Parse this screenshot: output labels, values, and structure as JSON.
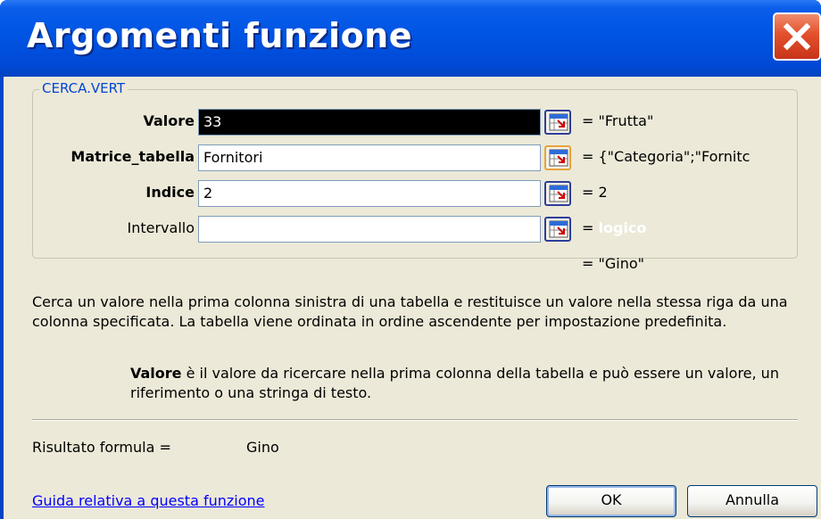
{
  "window": {
    "title": "Argomenti funzione"
  },
  "function_group": {
    "name": "CERCA.VERT",
    "arguments": [
      {
        "label": "Valore",
        "value": "33",
        "preview": "= \"Frutta\""
      },
      {
        "label": "Matrice_tabella",
        "value": "Fornitori",
        "preview": "= {\"Categoria\";\"Fornitc"
      },
      {
        "label": "Indice",
        "value": "2",
        "preview": "= 2"
      },
      {
        "label": "Intervallo",
        "value": "",
        "preview_eq": "=",
        "preview_hint": "logico"
      }
    ]
  },
  "function_result_preview": "= \"Gino\"",
  "description": "Cerca un valore nella prima colonna sinistra di una tabella e restituisce un valore nella stessa riga da una colonna specificata. La tabella viene ordinata in ordine ascendente per impostazione predefinita.",
  "argument_help": {
    "name": "Valore",
    "text": "è il valore da ricercare nella prima colonna della tabella e può essere un valore, un riferimento o una stringa di testo."
  },
  "result": {
    "label": "Risultato formula =",
    "value": "Gino"
  },
  "footer": {
    "help_link": "Guida relativa a questa funzione",
    "ok_label": "OK",
    "cancel_label": "Annulla"
  },
  "icons": {
    "close": "close-x-icon",
    "range_picker": "collapse-dialog-icon"
  },
  "colors": {
    "titlebar": "#0054E3",
    "dialog_bg": "#ECE9D8",
    "close_button": "#E2502C",
    "group_label": "#0046D5",
    "link": "#0000FF"
  }
}
